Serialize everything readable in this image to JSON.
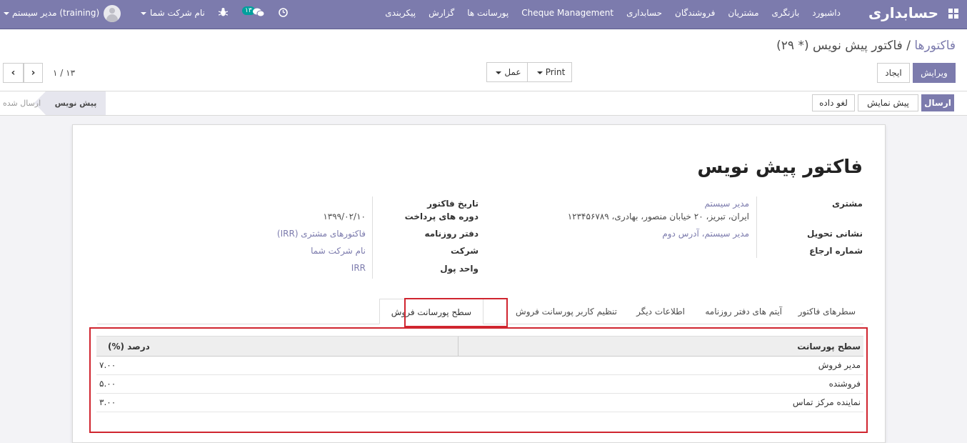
{
  "navbar": {
    "brand": "حسابداری",
    "menu": [
      "داشبورد",
      "بازنگری",
      "مشتریان",
      "فروشندگان",
      "حسابداری",
      "Cheque Management",
      "پورسانت ها",
      "گزارش",
      "پیکربندی"
    ],
    "user": "مدیر سیستم (training)",
    "company": "نام شرکت شما",
    "messages_count": "۱۳"
  },
  "control": {
    "breadcrumb_parent": "فاکتورها",
    "breadcrumb_sep": "/",
    "breadcrumb_current": "فاکتور پیش نویس (* ۲۹)",
    "edit": "ویرایش",
    "create": "ایجاد",
    "print": "Print",
    "action": "عمل",
    "pager": "۱ / ۱۳"
  },
  "status_actions": {
    "send": "ارسال",
    "preview": "پیش نمایش",
    "cancel": "لغو داده"
  },
  "stages": {
    "draft": "پیش نویس",
    "sent": "ارسال شده"
  },
  "form": {
    "title": "فاکتور پیش نویس",
    "labels": {
      "customer": "مشتری",
      "delivery_address": "نشانی تحویل",
      "reference": "شماره ارجاع",
      "invoice_date": "تاریخ فاکتور",
      "payment_terms": "دوره های پرداخت",
      "journal": "دفتر روزنامه",
      "company": "شرکت",
      "currency": "واحد پول"
    },
    "values": {
      "customer_name": "مدیر سیستم",
      "customer_address": "ایران، تبریز، ۲۰ خیابان منصور، بهادری، ۱۲۳۴۵۶۷۸۹",
      "delivery_address": "مدیر سیستم، آدرس دوم",
      "invoice_date": "۱۳۹۹/۰۲/۱۰",
      "journal": "فاکتورهای مشتری (IRR)",
      "company": "نام شرکت شما",
      "currency": "IRR"
    }
  },
  "tabs": [
    "سطرهای فاکتور",
    "آیتم های دفتر روزنامه",
    "اطلاعات دیگر",
    "تنظیم کاربر پورسانت فروش",
    "سطح پورسانت فروش"
  ],
  "table": {
    "headers": [
      "سطح پورسانت",
      "درصد (%)"
    ],
    "rows": [
      {
        "level": "مدیر فروش",
        "percent": "۷.۰۰"
      },
      {
        "level": "فروشنده",
        "percent": "۵.۰۰"
      },
      {
        "level": "نماینده مرکز تماس",
        "percent": "۳.۰۰"
      }
    ]
  }
}
